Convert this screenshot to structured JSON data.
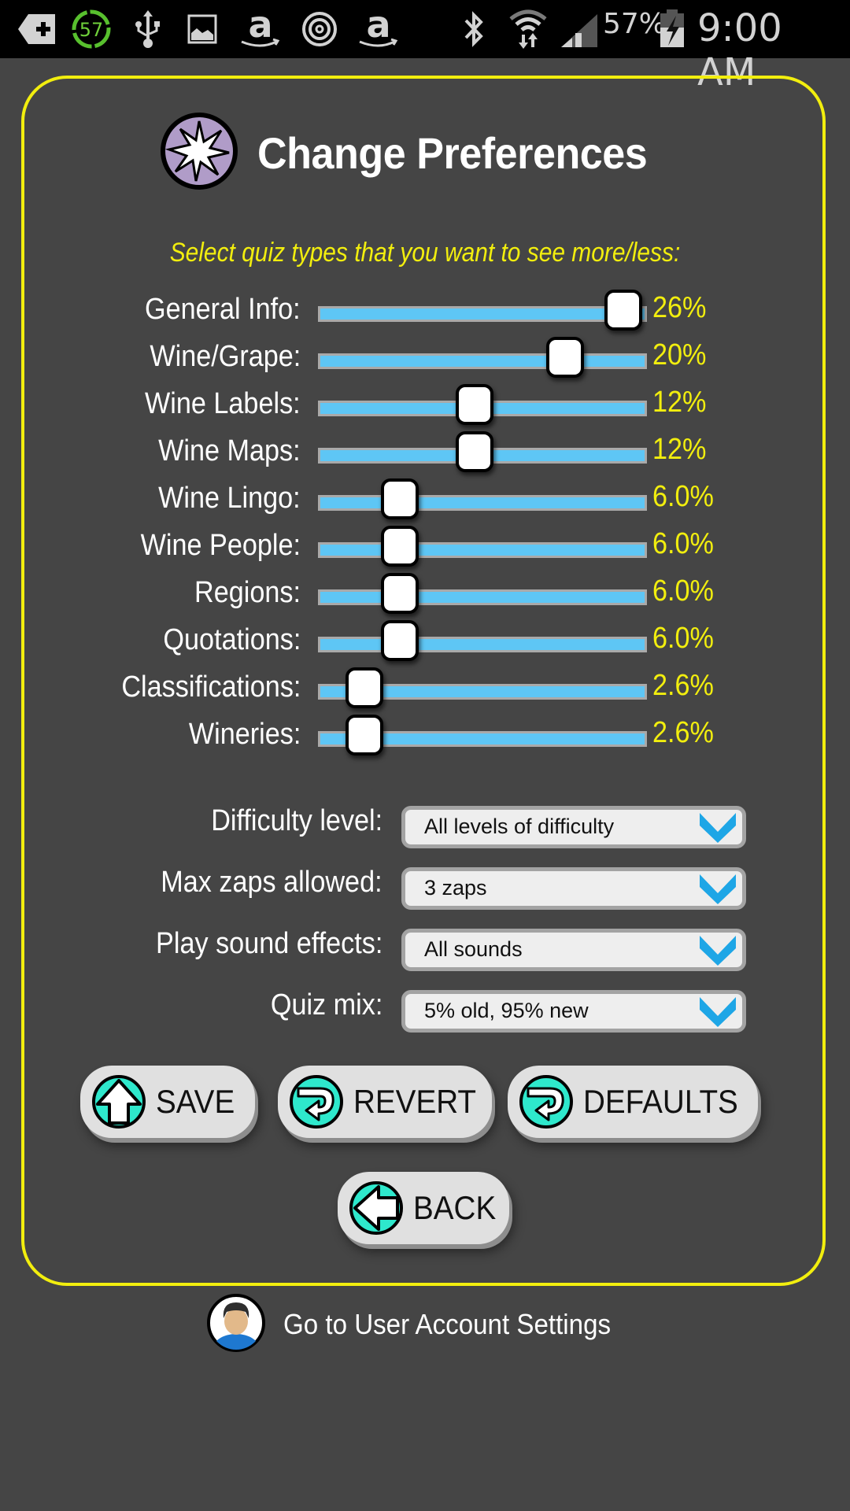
{
  "status_bar": {
    "notification_icons": [
      "add-tag-icon",
      "battery-ring-badge-icon",
      "usb-icon",
      "image-icon",
      "amazon-icon",
      "at-sign-icon",
      "amazon-icon"
    ],
    "badge_number": "57",
    "system_icons": [
      "bluetooth-icon",
      "wifi-icon",
      "signal-icon",
      "battery-charging-icon"
    ],
    "battery_percent": "57%",
    "time": "9:00 AM"
  },
  "header": {
    "icon": "star-burst-icon",
    "title": "Change Preferences"
  },
  "quiz_types": {
    "instruction": "Select quiz types that you want to see more/less:",
    "items": [
      {
        "label": "General Info:",
        "value": "26%",
        "level": 0.93
      },
      {
        "label": "Wine/Grape:",
        "value": "20%",
        "level": 0.75
      },
      {
        "label": "Wine Labels:",
        "value": "12%",
        "level": 0.47
      },
      {
        "label": "Wine Maps:",
        "value": "12%",
        "level": 0.47
      },
      {
        "label": "Wine Lingo:",
        "value": "6.0%",
        "level": 0.24
      },
      {
        "label": "Wine People:",
        "value": "6.0%",
        "level": 0.24
      },
      {
        "label": "Regions:",
        "value": "6.0%",
        "level": 0.24
      },
      {
        "label": "Quotations:",
        "value": "6.0%",
        "level": 0.24
      },
      {
        "label": "Classifications:",
        "value": "2.6%",
        "level": 0.13
      },
      {
        "label": "Wineries:",
        "value": "2.6%",
        "level": 0.13
      }
    ]
  },
  "settings": [
    {
      "label": "Difficulty level:",
      "value": "All levels of difficulty"
    },
    {
      "label": "Max zaps allowed:",
      "value": "3 zaps"
    },
    {
      "label": "Play sound effects:",
      "value": "All sounds"
    },
    {
      "label": "Quiz mix:",
      "value": "5% old, 95% new"
    }
  ],
  "buttons": {
    "save": "SAVE",
    "revert": "REVERT",
    "defaults": "DEFAULTS",
    "back": "BACK"
  },
  "footer": {
    "account_link": "Go to User Account Settings"
  },
  "colors": {
    "background": "#454545",
    "accent_yellow": "#f2ee0e",
    "slider_blue": "#5ec6f5",
    "icon_teal": "#2ee8cc",
    "caret_blue": "#1ea6e6"
  }
}
